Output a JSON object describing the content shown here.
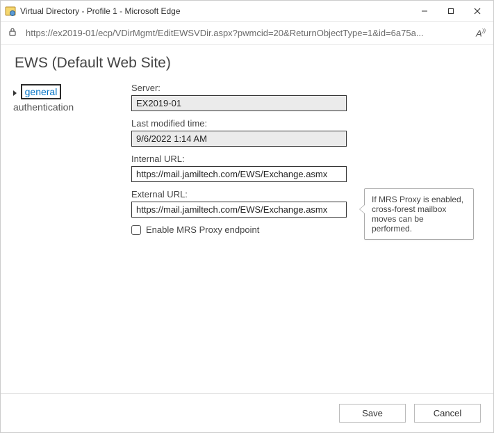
{
  "window": {
    "title": "Virtual Directory - Profile 1 - Microsoft Edge"
  },
  "address": {
    "url": "https://ex2019-01/ecp/VDirMgmt/EditEWSVDir.aspx?pwmcid=20&ReturnObjectType=1&id=6a75a..."
  },
  "page": {
    "title": "EWS (Default Web Site)"
  },
  "nav": {
    "items": [
      {
        "label": "general",
        "active": true
      },
      {
        "label": "authentication",
        "active": false
      }
    ]
  },
  "form": {
    "server_label": "Server:",
    "server_value": "EX2019-01",
    "modified_label": "Last modified time:",
    "modified_value": "9/6/2022 1:14 AM",
    "internal_label": "Internal URL:",
    "internal_value": "https://mail.jamiltech.com/EWS/Exchange.asmx",
    "external_label": "External URL:",
    "external_value": "https://mail.jamiltech.com/EWS/Exchange.asmx",
    "mrs_checkbox_label": "Enable MRS Proxy endpoint"
  },
  "callout": {
    "text": "If MRS Proxy is enabled, cross-forest mailbox moves can be performed."
  },
  "footer": {
    "save_label": "Save",
    "cancel_label": "Cancel"
  }
}
